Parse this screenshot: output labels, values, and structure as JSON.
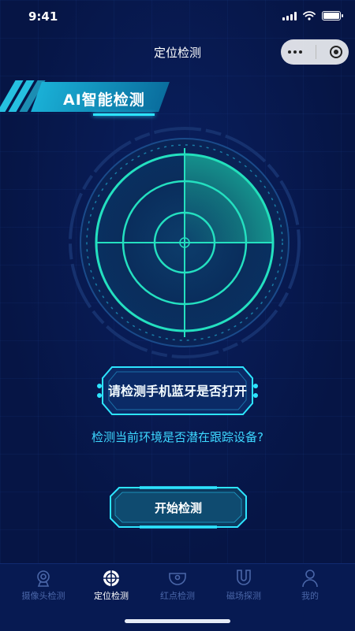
{
  "status_bar": {
    "time": "9:41"
  },
  "nav": {
    "title": "定位检测"
  },
  "banner": {
    "title": "AI智能检测"
  },
  "prompt": {
    "text": "请检测手机蓝牙是否打开"
  },
  "question": {
    "text": "检测当前环境是否潜在跟踪设备?"
  },
  "start_button": {
    "label": "开始检测"
  },
  "tabbar": {
    "items": [
      {
        "label": "摄像头检测",
        "icon": "camera-icon",
        "active": false
      },
      {
        "label": "定位检测",
        "icon": "crosshair-icon",
        "active": true
      },
      {
        "label": "红点检测",
        "icon": "red-dot-icon",
        "active": false
      },
      {
        "label": "磁场探测",
        "icon": "magnet-icon",
        "active": false
      },
      {
        "label": "我的",
        "icon": "user-icon",
        "active": false
      }
    ]
  },
  "colors": {
    "background": "#061545",
    "accent": "#2de4ff",
    "radar_green": "#1fe0b0",
    "tab_inactive": "#4a66a8"
  }
}
